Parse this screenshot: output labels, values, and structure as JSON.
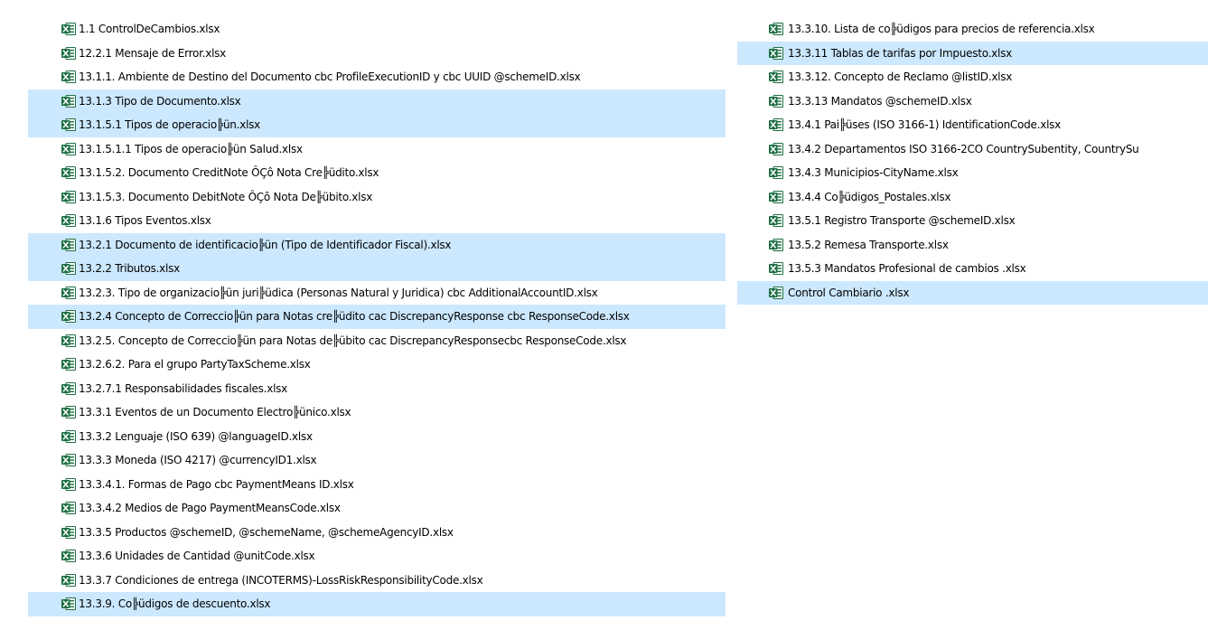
{
  "icon": {
    "name": "excel-file-icon",
    "colors": {
      "dark_green": "#1d6f42",
      "light_green": "#5cb37e",
      "white": "#ffffff"
    }
  },
  "colors": {
    "selection": "#cce8ff",
    "text": "#000000",
    "background": "#ffffff"
  },
  "files_left": [
    {
      "name": "1.1 ControlDeCambios.xlsx",
      "selected": false
    },
    {
      "name": "12.2.1 Mensaje de  Error.xlsx",
      "selected": false
    },
    {
      "name": "13.1.1. Ambiente de Destino del Documento cbc ProfileExecutionID y cbc UUID @schemeID.xlsx",
      "selected": false
    },
    {
      "name": "13.1.3 Tipo de Documento.xlsx",
      "selected": true
    },
    {
      "name": "13.1.5.1 Tipos de operacio╠ün.xlsx",
      "selected": true
    },
    {
      "name": "13.1.5.1.1 Tipos de operacio╠ün Salud.xlsx",
      "selected": false
    },
    {
      "name": "13.1.5.2. Documento CreditNote ÔÇô Nota Cre╠üdito.xlsx",
      "selected": false
    },
    {
      "name": "13.1.5.3. Documento DebitNote ÔÇô Nota De╠übito.xlsx",
      "selected": false
    },
    {
      "name": "13.1.6 Tipos Eventos.xlsx",
      "selected": false
    },
    {
      "name": "13.2.1 Documento de identificacio╠ün (Tipo de Identificador Fiscal).xlsx",
      "selected": true
    },
    {
      "name": "13.2.2 Tributos.xlsx",
      "selected": true
    },
    {
      "name": "13.2.3. Tipo de organizacio╠ün juri╠üdica (Personas Natural y Juridica) cbc AdditionalAccountID.xlsx",
      "selected": false
    },
    {
      "name": "13.2.4 Concepto de Correccio╠ün para Notas cre╠üdito cac DiscrepancyResponse cbc ResponseCode.xlsx",
      "selected": true
    },
    {
      "name": "13.2.5. Concepto de Correccio╠ün para Notas de╠übito cac DiscrepancyResponsecbc ResponseCode.xlsx",
      "selected": false
    },
    {
      "name": "13.2.6.2. Para el grupo PartyTaxScheme.xlsx",
      "selected": false
    },
    {
      "name": "13.2.7.1 Responsabilidades fiscales.xlsx",
      "selected": false
    },
    {
      "name": "13.3.1 Eventos de un Documento Electro╠ünico.xlsx",
      "selected": false
    },
    {
      "name": "13.3.2 Lenguaje (ISO 639) @languageID.xlsx",
      "selected": false
    },
    {
      "name": "13.3.3 Moneda (ISO 4217) @currencyID1.xlsx",
      "selected": false
    },
    {
      "name": "13.3.4.1. Formas de Pago cbc PaymentMeans ID.xlsx",
      "selected": false
    },
    {
      "name": "13.3.4.2 Medios de Pago PaymentMeansCode.xlsx",
      "selected": false
    },
    {
      "name": "13.3.5 Productos @schemeID, @schemeName, @schemeAgencyID.xlsx",
      "selected": false
    },
    {
      "name": "13.3.6 Unidades de Cantidad @unitCode.xlsx",
      "selected": false
    },
    {
      "name": "13.3.7 Condiciones de entrega (INCOTERMS)-LossRiskResponsibilityCode.xlsx",
      "selected": false
    },
    {
      "name": "13.3.9. Co╠üdigos de descuento.xlsx",
      "selected": true
    }
  ],
  "files_right": [
    {
      "name": "13.3.10. Lista de co╠üdigos para precios de referencia.xlsx",
      "selected": false
    },
    {
      "name": "13.3.11 Tablas de tarifas por Impuesto.xlsx",
      "selected": true
    },
    {
      "name": "13.3.12. Concepto de Reclamo @listID.xlsx",
      "selected": false
    },
    {
      "name": "13.3.13 Mandatos @schemeID.xlsx",
      "selected": false
    },
    {
      "name": "13.4.1 Pai╠üses (ISO 3166-1) IdentificationCode.xlsx",
      "selected": false
    },
    {
      "name": "13.4.2 Departamentos ISO 3166-2CO CountrySubentity, CountrySu",
      "selected": false
    },
    {
      "name": "13.4.3 Municipios-CityName.xlsx",
      "selected": false
    },
    {
      "name": "13.4.4 Co╠üdigos_Postales.xlsx",
      "selected": false
    },
    {
      "name": "13.5.1 Registro Transporte @schemeID.xlsx",
      "selected": false
    },
    {
      "name": "13.5.2 Remesa Transporte.xlsx",
      "selected": false
    },
    {
      "name": "13.5.3 Mandatos Profesional de cambios .xlsx",
      "selected": false
    },
    {
      "name": "Control Cambiario .xlsx",
      "selected": true
    }
  ]
}
